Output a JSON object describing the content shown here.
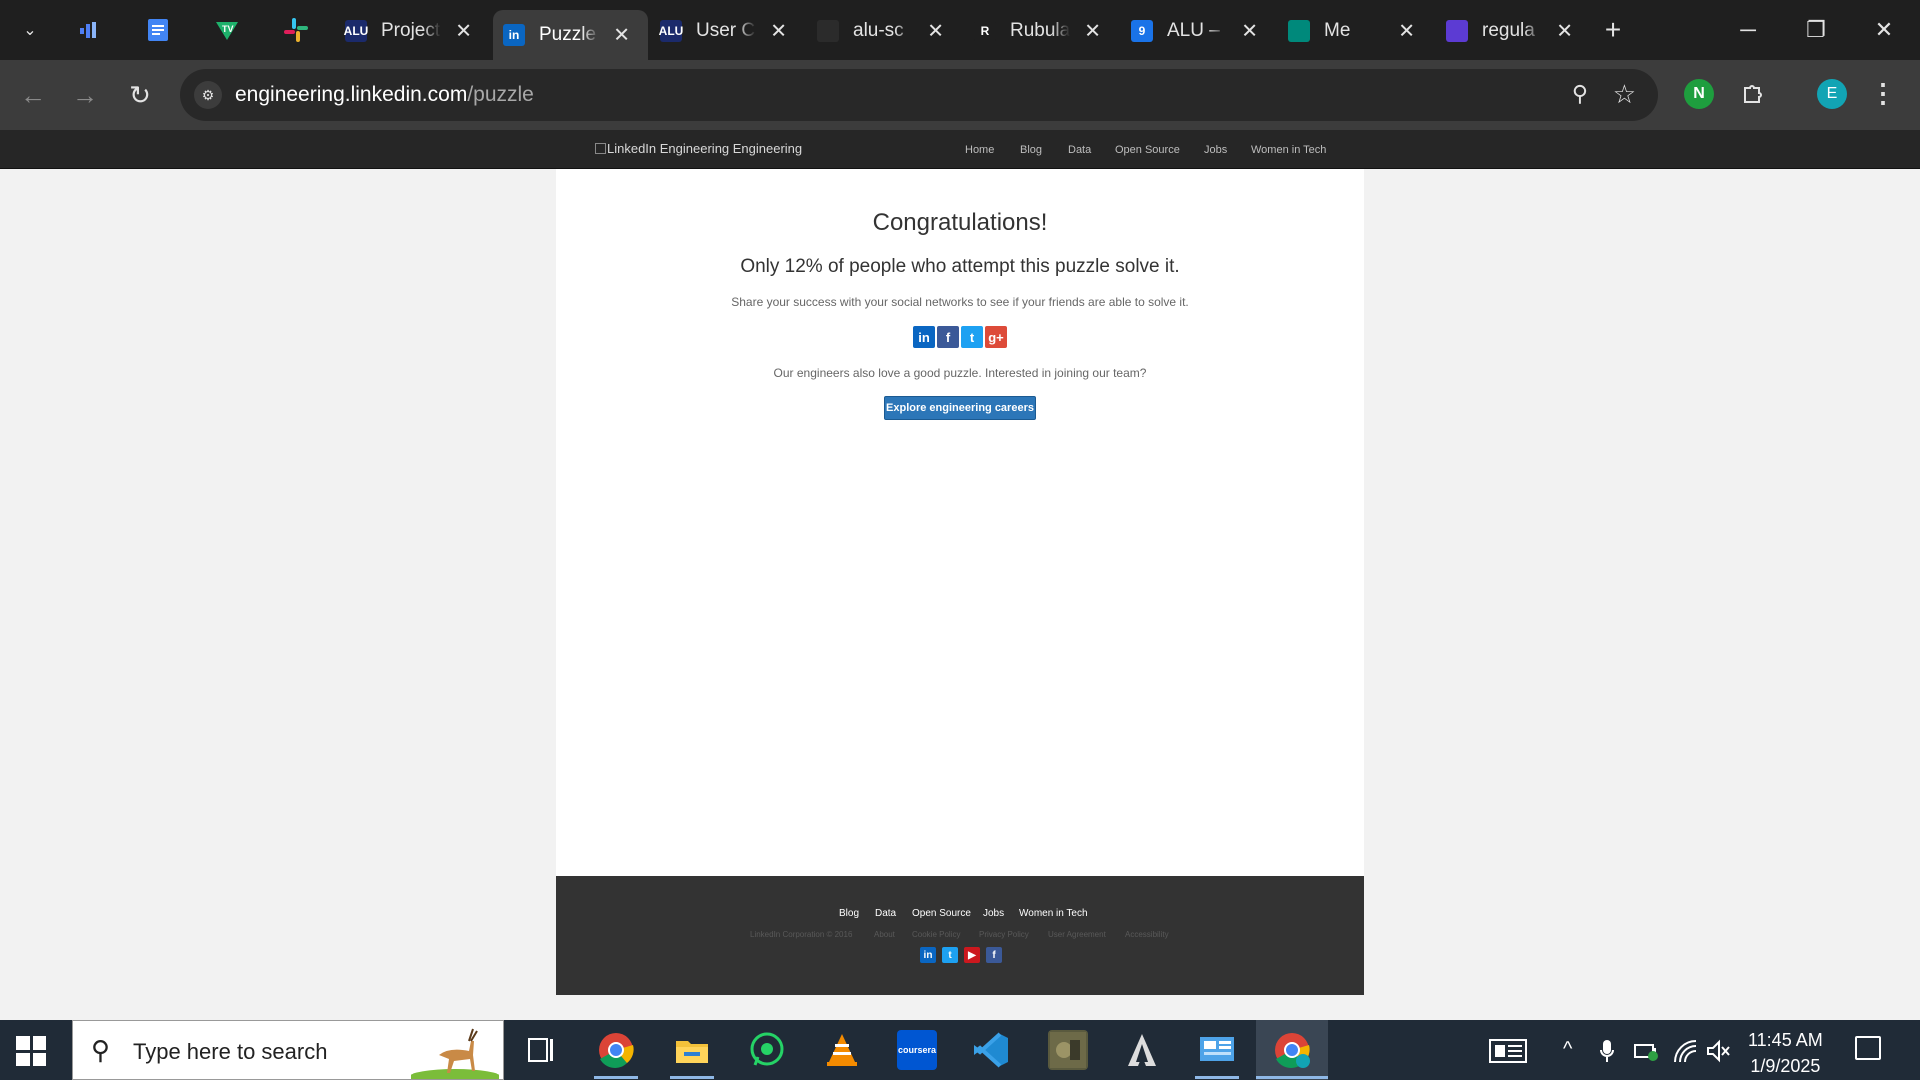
{
  "browser": {
    "pinned_tabs": [
      {
        "icon": "analytics-icon",
        "color": "#4f7ff5"
      },
      {
        "icon": "google-docs-icon",
        "color": "#4285f4"
      },
      {
        "icon": "tradingview-icon",
        "color": "#1eb16b"
      },
      {
        "icon": "slack-icon",
        "color": "#e01e5a"
      }
    ],
    "tabs": [
      {
        "title": "Project",
        "icon": "alu-icon",
        "fav_text": "ALU",
        "fav_color": "#1b2a6b",
        "active": false
      },
      {
        "title": "Puzzle",
        "icon": "linkedin-icon",
        "fav_text": "in",
        "fav_color": "#0a66c2",
        "active": true
      },
      {
        "title": "User C",
        "icon": "alu-icon",
        "fav_text": "ALU",
        "fav_color": "#1b2a6b",
        "active": false
      },
      {
        "title": "alu-sc",
        "icon": "github-icon",
        "fav_text": "",
        "fav_color": "#2b2b2b",
        "active": false
      },
      {
        "title": "Rubula",
        "icon": "rubula-icon",
        "fav_text": "R",
        "fav_color": "#1f1f1f",
        "active": false
      },
      {
        "title": "ALU –",
        "icon": "google-classroom-icon",
        "fav_text": "9",
        "fav_color": "#1a73e8",
        "active": false
      },
      {
        "title": "Me",
        "icon": "google-meet-icon",
        "fav_text": "",
        "fav_color": "#00897b",
        "active": false
      },
      {
        "title": "regula",
        "icon": "regex-icon",
        "fav_text": "",
        "fav_color": "#5c3bd3",
        "active": false
      }
    ],
    "url_domain": "engineering.linkedin.com",
    "url_path": "/puzzle",
    "profile_initial": "E"
  },
  "site": {
    "logo_alt": "LinkedIn Engineering Engineering",
    "nav": [
      "Home",
      "Blog",
      "Data",
      "Open Source",
      "Jobs",
      "Women in Tech"
    ]
  },
  "main": {
    "heading": "Congratulations!",
    "stat": "Only 12% of people who attempt this puzzle solve it.",
    "share_prompt": "Share your success with your social networks to see if your friends are able to solve it.",
    "share_icons": [
      {
        "name": "linkedin-icon",
        "glyph": "in",
        "color": "#0a66c2"
      },
      {
        "name": "facebook-icon",
        "glyph": "f",
        "color": "#3b5998"
      },
      {
        "name": "twitter-icon",
        "glyph": "t",
        "color": "#1da1f2"
      },
      {
        "name": "google-plus-icon",
        "glyph": "g+",
        "color": "#dd4b39"
      }
    ],
    "join_prompt": "Our engineers also love a good puzzle. Interested in joining our team?",
    "cta_label": "Explore engineering careers"
  },
  "footer": {
    "links": [
      "Blog",
      "Data",
      "Open Source",
      "Jobs",
      "Women in Tech"
    ],
    "legal": [
      "LinkedIn Corporation © 2016",
      "About",
      "Cookie Policy",
      "Privacy Policy",
      "User Agreement",
      "Accessibility"
    ],
    "social": [
      {
        "name": "linkedin-icon",
        "glyph": "in",
        "color": "#0a66c2"
      },
      {
        "name": "twitter-icon",
        "glyph": "t",
        "color": "#1da1f2"
      },
      {
        "name": "youtube-icon",
        "glyph": "▶",
        "color": "#cc181e"
      },
      {
        "name": "facebook-icon",
        "glyph": "f",
        "color": "#3b5998"
      }
    ]
  },
  "taskbar": {
    "search_placeholder": "Type here to search",
    "apps": [
      {
        "name": "task-view-icon"
      },
      {
        "name": "chrome-icon"
      },
      {
        "name": "file-explorer-icon"
      },
      {
        "name": "whatsapp-icon"
      },
      {
        "name": "vlc-icon"
      },
      {
        "name": "coursera-icon",
        "label": "coursera"
      },
      {
        "name": "vscode-icon"
      },
      {
        "name": "game-icon"
      },
      {
        "name": "assassins-creed-icon"
      },
      {
        "name": "control-panel-icon"
      },
      {
        "name": "chrome-profile-icon"
      }
    ],
    "time": "11:45 AM",
    "date": "1/9/2025"
  }
}
